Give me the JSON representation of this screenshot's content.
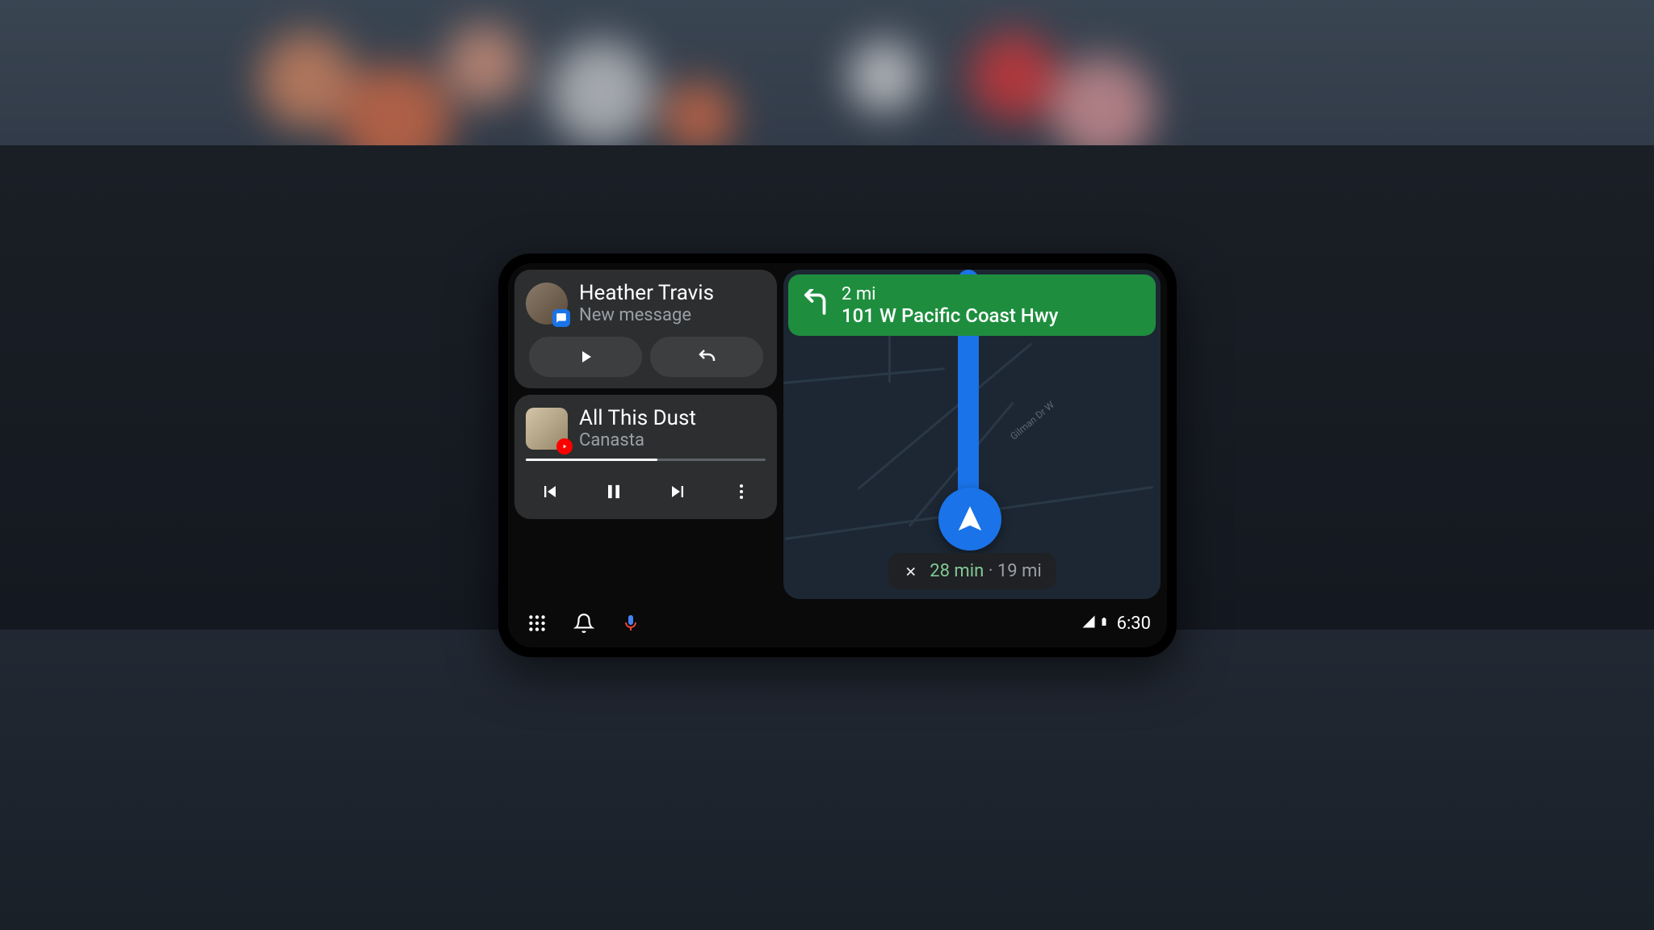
{
  "message": {
    "sender": "Heather Travis",
    "subtitle": "New message"
  },
  "music": {
    "track": "All This Dust",
    "artist": "Canasta",
    "progress_percent": 55
  },
  "navigation": {
    "turn_distance": "2 mi",
    "turn_street": "101 W Pacific Coast Hwy",
    "road_label_1": "Gilman Dr W",
    "trip_time": "28 min",
    "trip_separator": "·",
    "trip_distance": "19 mi"
  },
  "status": {
    "time": "6:30"
  },
  "colors": {
    "nav_green": "#1e8e3e",
    "route_blue": "#1a73e8"
  }
}
